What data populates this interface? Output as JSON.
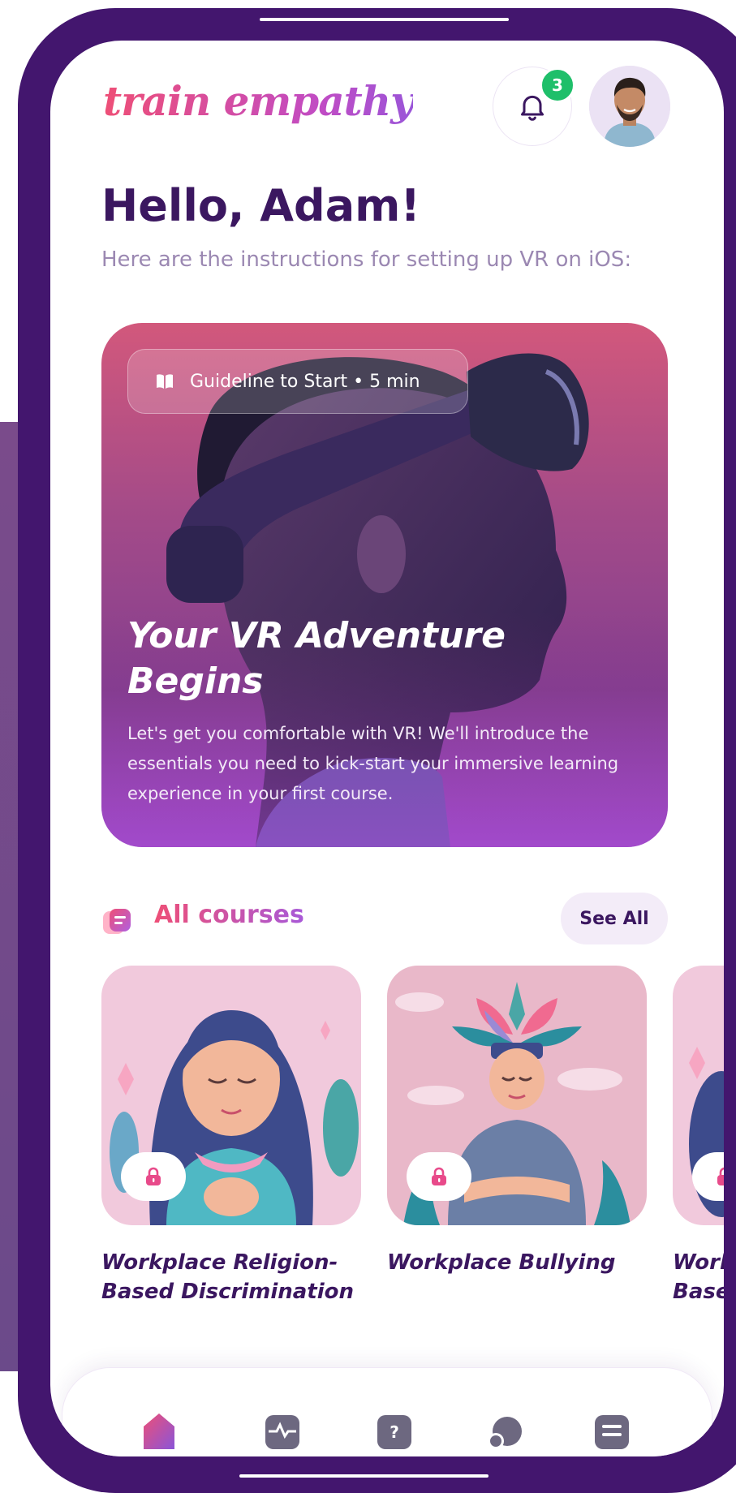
{
  "app": {
    "logo_text": "train empathy",
    "notifications": {
      "count": "3"
    },
    "user": {
      "avatar_alt": "Adam"
    }
  },
  "greeting": {
    "title": "Hello, Adam!",
    "subtitle": "Here are the instructions  for setting up VR on iOS:"
  },
  "hero": {
    "pill_label": "Guideline to Start • 5 min",
    "title": "Your VR Adventure Begins",
    "description": "Let's get you comfortable with VR! We'll introduce the essentials you need to kick-start your immersive learning experience in your first course."
  },
  "courses": {
    "section_title": "All courses",
    "see_all_label": "See All",
    "items": [
      {
        "title": "Workplace Religion-Based Discrimination",
        "locked": true
      },
      {
        "title": "Workplace Bullying",
        "locked": true
      },
      {
        "title": "Workplace Religion-Based Discrimination",
        "locked": true
      }
    ]
  },
  "nav": {
    "items": [
      {
        "icon": "home-icon",
        "active": true
      },
      {
        "icon": "activity-icon",
        "active": false
      },
      {
        "icon": "help-icon",
        "active": false
      },
      {
        "icon": "chat-icon",
        "active": false
      },
      {
        "icon": "menu-icon",
        "active": false
      }
    ]
  },
  "colors": {
    "brand_dark": "#3b1760",
    "phone_frame": "#43166e",
    "accent_pink": "#ee4f77",
    "accent_purple": "#a859d8",
    "badge_green": "#1fbf6a"
  }
}
